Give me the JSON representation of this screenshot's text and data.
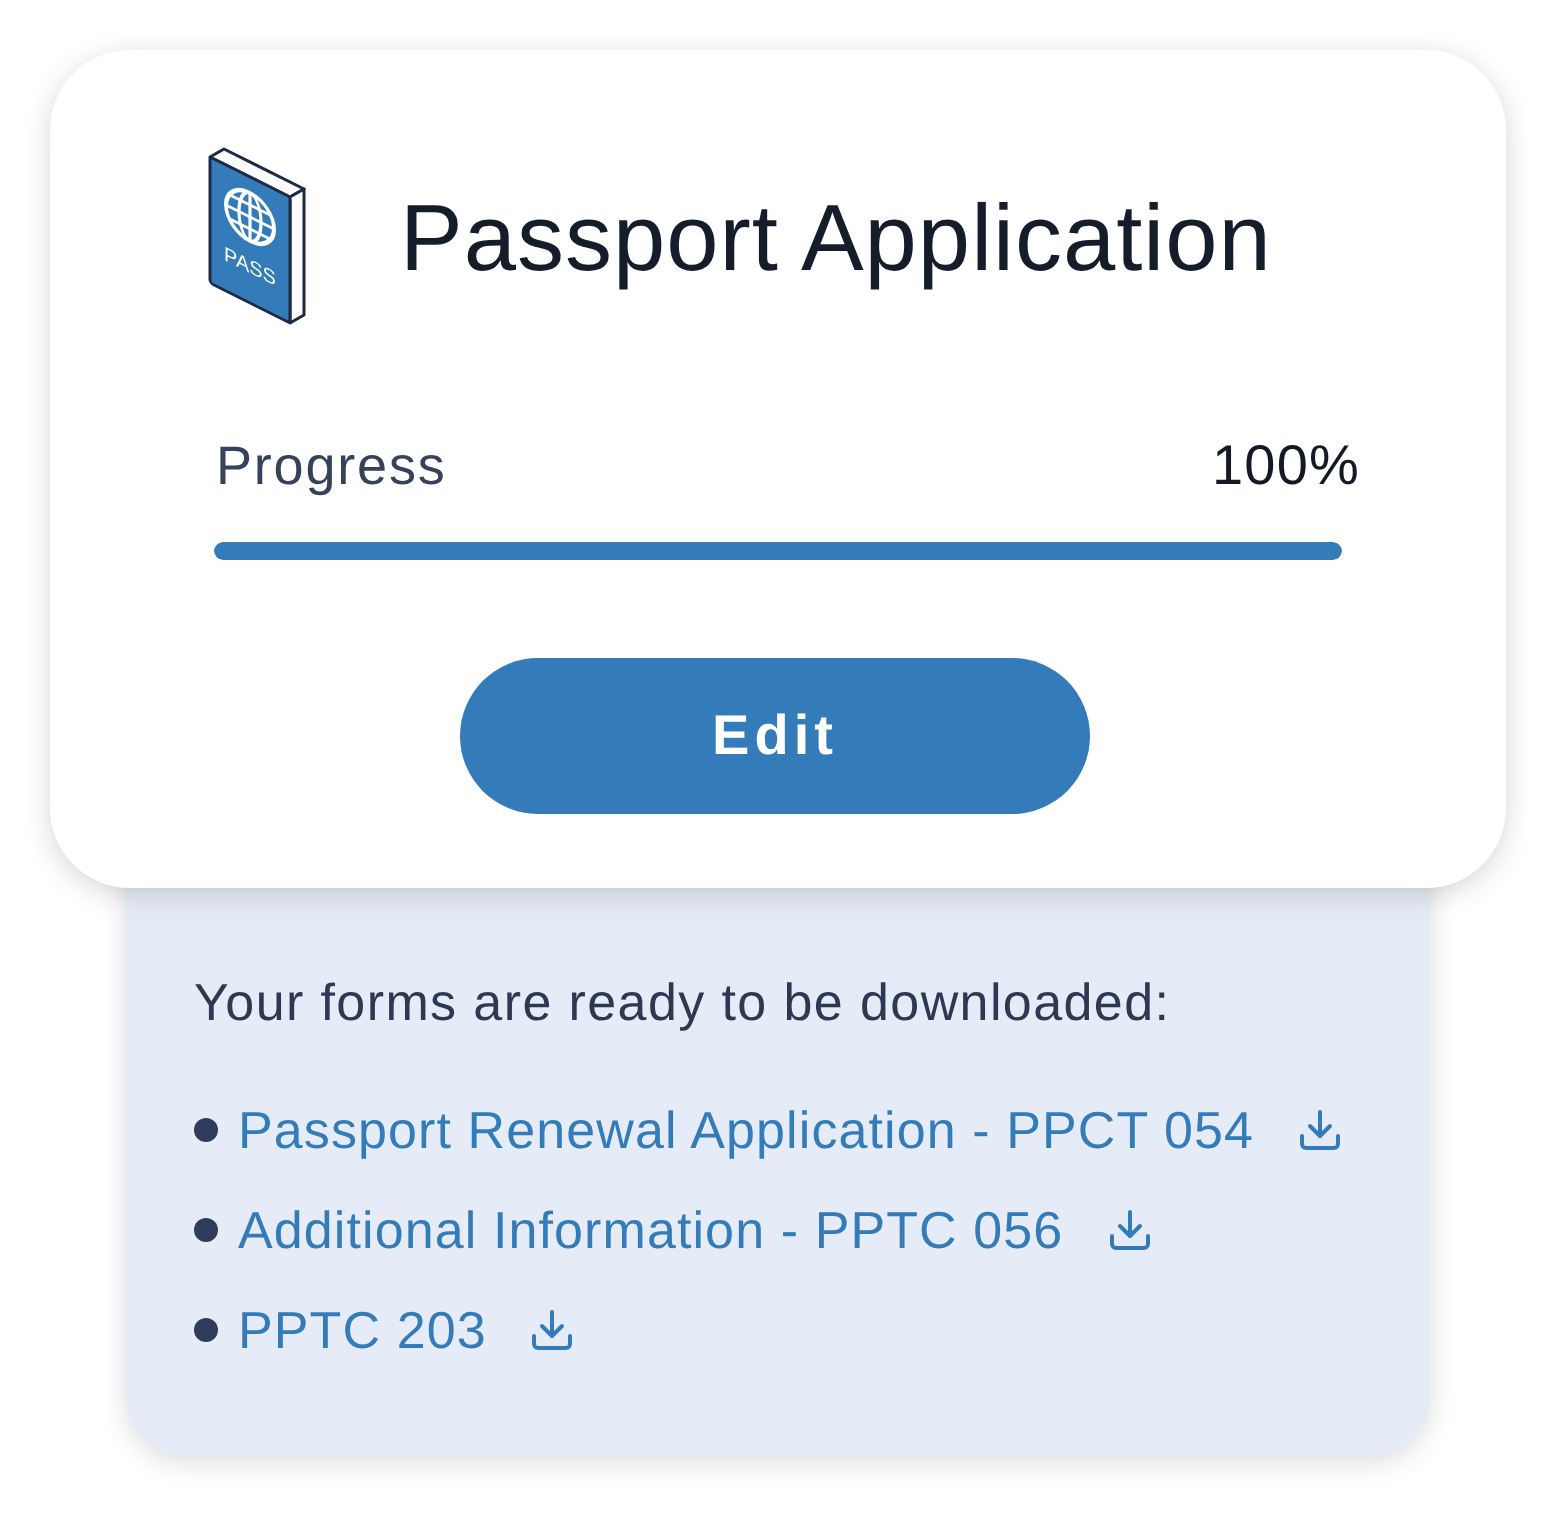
{
  "card": {
    "icon_label": "PASS",
    "title": "Passport Application",
    "progress": {
      "label": "Progress",
      "value": "100%",
      "level": 1
    },
    "button": "Edit"
  },
  "downloads": {
    "intro": "Your forms are ready to be downloaded:",
    "files": [
      {
        "name": "Passport Renewal Application - PPCT 054"
      },
      {
        "name": "Additional Information - PPTC 056"
      },
      {
        "name": "PPTC 203"
      }
    ]
  }
}
